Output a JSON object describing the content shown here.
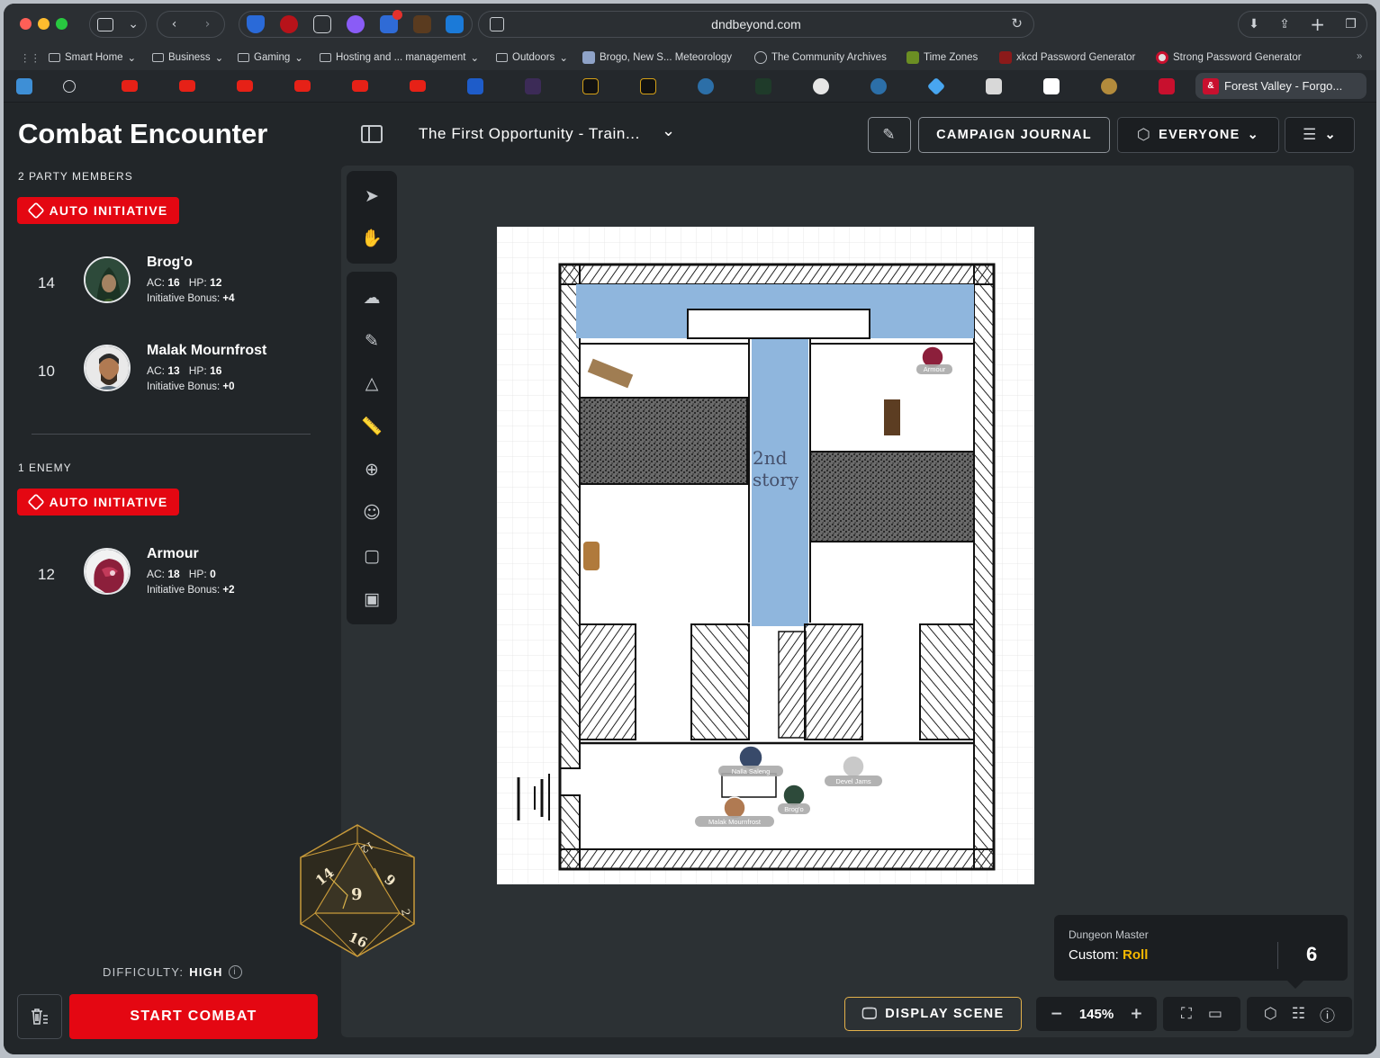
{
  "browser": {
    "url": "dndbeyond.com",
    "bookmarks": [
      "Smart Home",
      "Business",
      "Gaming",
      "Hosting and ... management",
      "Outdoors",
      "Brogo, New S... Meteorology",
      "The Community Archives",
      "Time Zones",
      "xkcd Password Generator",
      "Strong Password Generator"
    ],
    "active_tab": "Forest Valley - Forgo...",
    "active_tab_icon": "&"
  },
  "sidebar": {
    "title": "Combat Encounter",
    "party_label": "2 PARTY MEMBERS",
    "auto_initiative": "AUTO INITIATIVE",
    "party": [
      {
        "initiative": "14",
        "name": "Brog'o",
        "ac_label": "AC:",
        "ac": "16",
        "hp_label": "HP:",
        "hp": "12",
        "bonus_label": "Initiative Bonus:",
        "bonus": "+4"
      },
      {
        "initiative": "10",
        "name": "Malak Mournfrost",
        "ac_label": "AC:",
        "ac": "13",
        "hp_label": "HP:",
        "hp": "16",
        "bonus_label": "Initiative Bonus:",
        "bonus": "+0"
      }
    ],
    "enemy_label": "1 ENEMY",
    "enemies": [
      {
        "initiative": "12",
        "name": "Armour",
        "ac_label": "AC:",
        "ac": "18",
        "hp_label": "HP:",
        "hp": "0",
        "bonus_label": "Initiative Bonus:",
        "bonus": "+2"
      }
    ],
    "difficulty_label": "DIFFICULTY:",
    "difficulty_value": "HIGH",
    "start_combat": "START COMBAT"
  },
  "header": {
    "scene_title": "The First Opportunity - Train...",
    "campaign_journal": "CAMPAIGN JOURNAL",
    "audience": "EVERYONE"
  },
  "map": {
    "room_label_line1": "2nd",
    "room_label_line2": "story",
    "tokens": [
      "Armour",
      "Nalla Saleng",
      "Devel Jams",
      "Brog'o",
      "Malak Mournfrost"
    ]
  },
  "roll": {
    "roller": "Dungeon Master",
    "kind_label": "Custom:",
    "kind_value": "Roll",
    "result": "6"
  },
  "bottom": {
    "display_scene": "DISPLAY SCENE",
    "zoom": "145%"
  },
  "dice_faces": [
    "14",
    "9",
    "9",
    "16",
    "12",
    "2"
  ],
  "colors": {
    "accent_red": "#e40712",
    "gold": "#f5b700",
    "display_border": "#e3b14a",
    "water": "#8fb6dd"
  }
}
